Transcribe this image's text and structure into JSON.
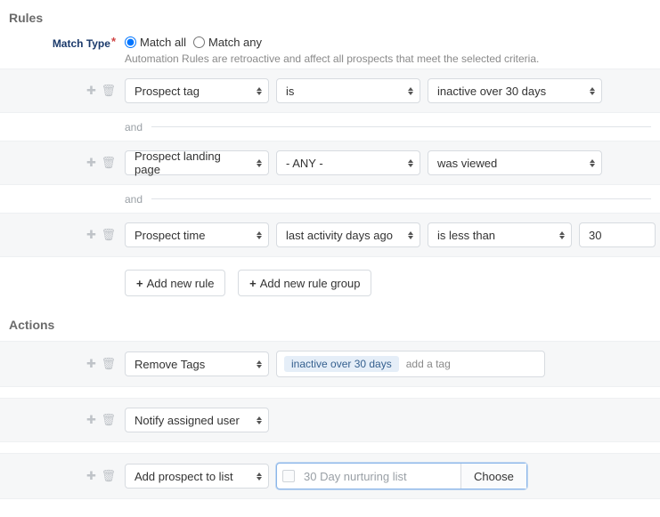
{
  "sections": {
    "rules_title": "Rules",
    "actions_title": "Actions"
  },
  "match": {
    "label": "Match Type",
    "options": {
      "match_all": "Match all",
      "match_any": "Match any"
    },
    "selected": "match_all",
    "help": "Automation Rules are retroactive and affect all prospects that meet the selected criteria."
  },
  "rules": [
    {
      "field": "Prospect tag",
      "operator": "is",
      "value_select": "inactive over 30 days",
      "value_text": null
    },
    {
      "field": "Prospect landing page",
      "operator": "- ANY -",
      "value_select": "was viewed",
      "value_text": null
    },
    {
      "field": "Prospect time",
      "operator": "last activity days ago",
      "value_select": "is less than",
      "value_text": "30"
    }
  ],
  "joiner": "and",
  "buttons": {
    "add_rule": "Add new rule",
    "add_rule_group": "Add new rule group",
    "choose": "Choose"
  },
  "actions": [
    {
      "type": "Remove Tags",
      "tags": [
        "inactive over 30 days"
      ],
      "tag_placeholder": "add a tag"
    },
    {
      "type": "Notify assigned user"
    },
    {
      "type": "Add prospect to list",
      "list_value": "30 Day nurturing list"
    }
  ]
}
